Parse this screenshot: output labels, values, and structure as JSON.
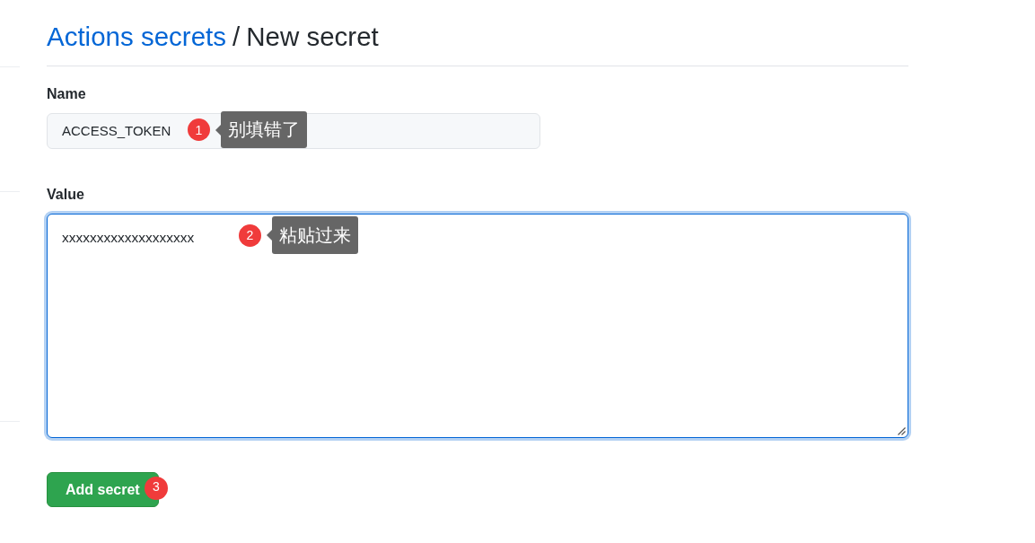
{
  "breadcrumb": {
    "link": "Actions secrets",
    "separator": "/",
    "current": "New secret"
  },
  "fields": [
    {
      "kind": "input",
      "label": "Name",
      "value": "ACCESS_TOKEN",
      "focused": false,
      "step": "1",
      "note": "别填错了"
    },
    {
      "kind": "textarea",
      "label": "Value",
      "value": "xxxxxxxxxxxxxxxxxxx",
      "focused": true,
      "step": "2",
      "note": "粘贴过来"
    }
  ],
  "submit_button": {
    "label": "Add secret",
    "step": "3"
  }
}
